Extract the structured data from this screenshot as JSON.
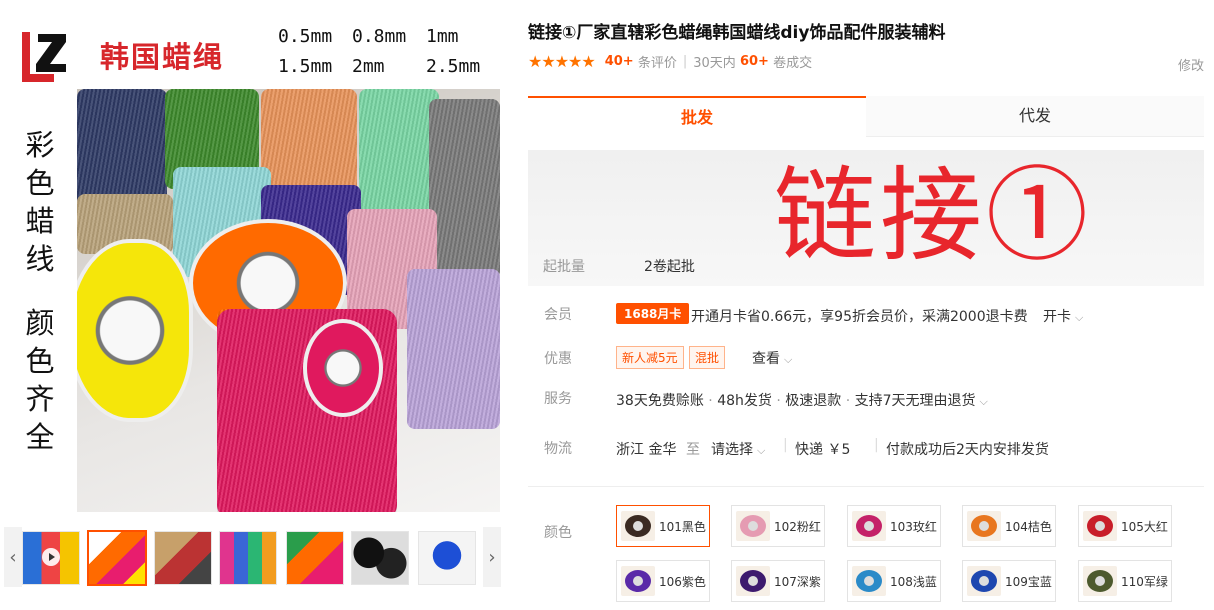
{
  "banner": {
    "title": "韩国蜡绳",
    "sizes_row1": [
      "0.5mm",
      "0.8mm",
      "1mm"
    ],
    "sizes_row2": [
      "1.5mm",
      "2mm",
      "2.5mm"
    ],
    "vertical_1": [
      "彩",
      "色",
      "蜡",
      "线"
    ],
    "vertical_2": [
      "颜",
      "色",
      "齐",
      "全"
    ]
  },
  "thumbnails": {
    "prev_glyph": "‹",
    "next_glyph": "›",
    "items": [
      {
        "name": "video-thumb",
        "colors": [
          "#2a6fd6",
          "#e44",
          "#f5c400"
        ]
      },
      {
        "name": "thumb-2",
        "colors": [
          "#e81d6e",
          "#ff6a00",
          "#ffe100"
        ]
      },
      {
        "name": "thumb-3",
        "colors": [
          "#c7a06a",
          "#b33",
          "#444"
        ]
      },
      {
        "name": "thumb-4",
        "colors": [
          "#e0348e",
          "#3a66d6",
          "#2bb673"
        ]
      },
      {
        "name": "thumb-5",
        "colors": [
          "#e81d6e",
          "#ff6a00",
          "#2a9d4b"
        ]
      },
      {
        "name": "thumb-6",
        "colors": [
          "#111",
          "#333",
          "#ddd"
        ]
      },
      {
        "name": "thumb-7",
        "colors": [
          "#1d4fd6",
          "#3b6ef0",
          "#eee"
        ]
      }
    ]
  },
  "product": {
    "title": "链接①厂家直辖彩色蜡绳韩国蜡线diy饰品配件服装辅料",
    "stars": "★★★★★",
    "reviews_count": "40+",
    "reviews_label": "条评价",
    "sales_prefix": "30天内",
    "sales_count": "60+",
    "sales_label": "卷成交",
    "edit_label": "修改"
  },
  "tabs": [
    {
      "label": "批发"
    },
    {
      "label": "代发"
    }
  ],
  "price_box": {
    "overlay_text": "链接①",
    "moq_label": "起批量",
    "moq_value": "2卷起批"
  },
  "member": {
    "label": "会员",
    "badge": "1688月卡",
    "text": "开通月卡省0.66元，享95折会员价，采满2000退卡费",
    "action": "开卡"
  },
  "discount": {
    "label": "优惠",
    "coupon_1": "新人减5元",
    "coupon_2": "混批",
    "action": "查看"
  },
  "service": {
    "label": "服务",
    "items": [
      "38天免费赊账",
      "48h发货",
      "极速退款",
      "支持7天无理由退货"
    ]
  },
  "logistics": {
    "label": "物流",
    "origin": "浙江 金华",
    "to": "至",
    "destination": "请选择",
    "express": "快递 ￥5",
    "note": "付款成功后2天内安排发货"
  },
  "colors": {
    "label": "颜色",
    "options": [
      {
        "label": "101黑色",
        "color": "#3a2a22"
      },
      {
        "label": "102粉红",
        "color": "#e59bb2"
      },
      {
        "label": "103玫红",
        "color": "#c42168"
      },
      {
        "label": "104桔色",
        "color": "#e8761f"
      },
      {
        "label": "105大红",
        "color": "#c81e2a"
      },
      {
        "label": "106紫色",
        "color": "#5a2aa8"
      },
      {
        "label": "107深紫",
        "color": "#3d1a6e"
      },
      {
        "label": "108浅蓝",
        "color": "#2a8ac8"
      },
      {
        "label": "109宝蓝",
        "color": "#1e47b0"
      },
      {
        "label": "110军绿",
        "color": "#4d5a2e"
      }
    ]
  }
}
